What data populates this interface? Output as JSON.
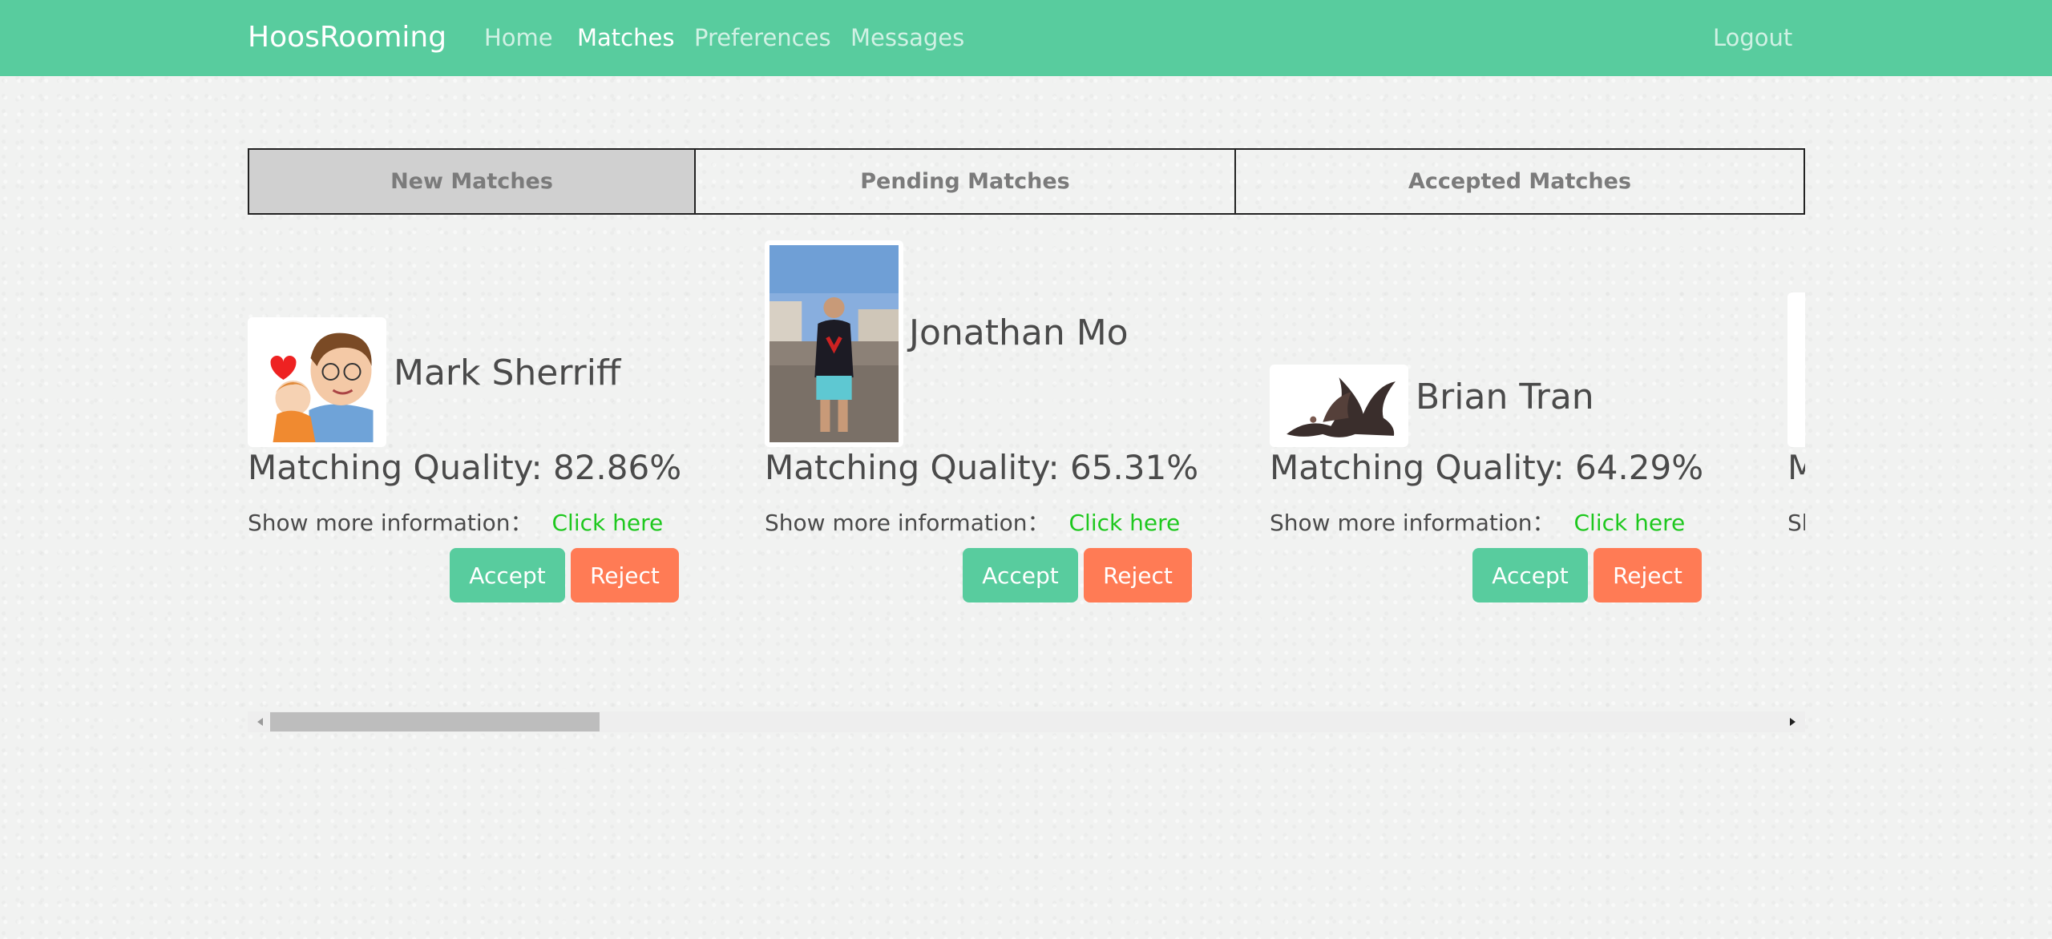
{
  "nav": {
    "brand": "HoosRooming",
    "links": [
      "Home",
      "Matches",
      "Preferences",
      "Messages"
    ],
    "active": "Matches",
    "logout": "Logout"
  },
  "tabs": [
    "New Matches",
    "Pending Matches",
    "Accepted Matches"
  ],
  "selected_tab": "New Matches",
  "labels": {
    "more_info": "Show more information：",
    "click_here": "Click here",
    "accept": "Accept",
    "reject": "Reject"
  },
  "matches": [
    {
      "name": "Mark Sherriff",
      "quality": "Matching Quality: 82.86%",
      "avatar": "cartoon-avatar"
    },
    {
      "name": "Jonathan Mo",
      "quality": "Matching Quality: 65.31%",
      "avatar": "beach-photo"
    },
    {
      "name": "Brian Tran",
      "quality": "Matching Quality: 64.29%",
      "avatar": "dragon-image"
    },
    {
      "name": "",
      "quality": "Matching Quality:",
      "avatar": "photo"
    }
  ],
  "colors": {
    "navbar": "#58cc9e",
    "accept": "#58cc9e",
    "reject": "#ff7b55",
    "link": "#1ec81e",
    "selected_tab": "#d0d0d0"
  },
  "scrollbar": {
    "thumb_fraction": 0.21,
    "position_fraction": 0.0
  }
}
